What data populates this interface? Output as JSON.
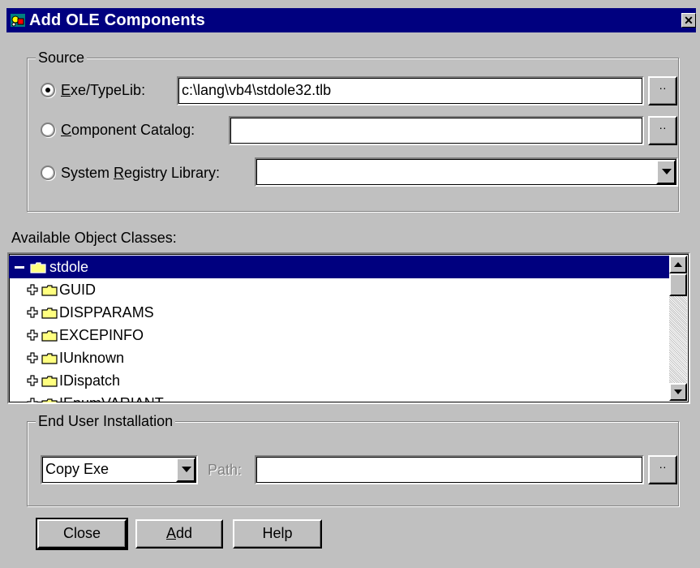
{
  "window": {
    "title": "Add OLE Components",
    "close_glyph": "✕"
  },
  "source": {
    "group_label": "Source",
    "exe_label_pre": "",
    "exe_label_ak": "E",
    "exe_label_post": "xe/TypeLib:",
    "exe_value": "c:\\lang\\vb4\\stdole32.tlb",
    "catalog_label_pre": "",
    "catalog_label_ak": "C",
    "catalog_label_post": "omponent Catalog:",
    "catalog_value": "",
    "registry_label_pre": "System ",
    "registry_label_ak": "R",
    "registry_label_post": "egistry Library:",
    "registry_value": "",
    "browse_glyph": "··",
    "selected_option": "exe"
  },
  "classes": {
    "label": "Available Object Classes:",
    "tree": [
      {
        "label": "stdole",
        "level": 0,
        "expanded": true,
        "selected": true
      },
      {
        "label": "GUID",
        "level": 1
      },
      {
        "label": "DISPPARAMS",
        "level": 1
      },
      {
        "label": "EXCEPINFO",
        "level": 1
      },
      {
        "label": "IUnknown",
        "level": 1
      },
      {
        "label": "IDispatch",
        "level": 1
      },
      {
        "label": "IEnumVARIANT",
        "level": 1
      }
    ]
  },
  "install": {
    "group_label": "End User Installation",
    "mode_value": "Copy Exe",
    "path_label": "Path:",
    "path_value": ""
  },
  "buttons": {
    "close": "Close",
    "add_pre": "",
    "add_ak": "A",
    "add_post": "dd",
    "help": "Help"
  },
  "colors": {
    "title_bar": "#00007f",
    "face": "#c0c0c0",
    "selection": "#00007f"
  }
}
